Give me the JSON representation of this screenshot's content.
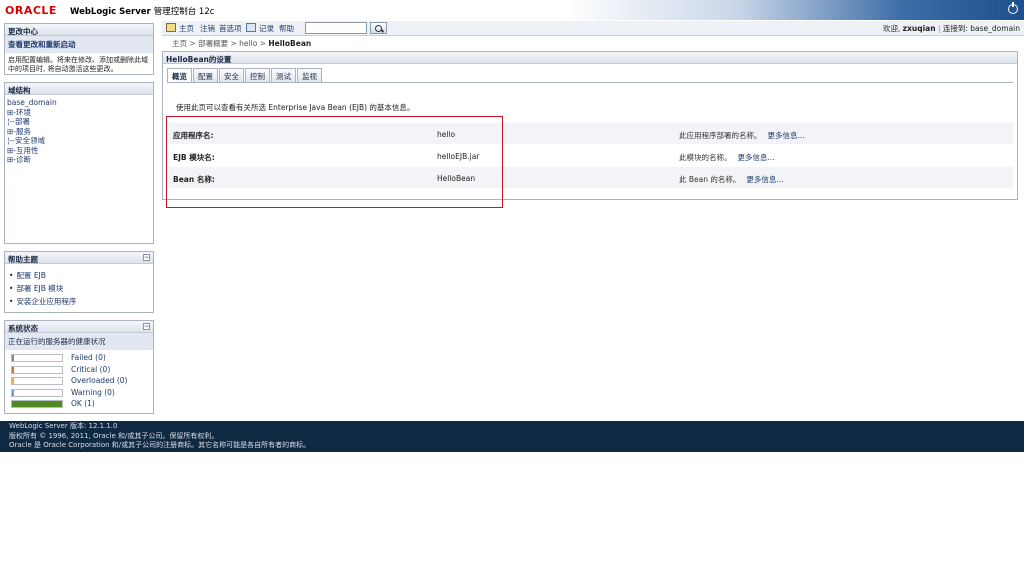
{
  "header": {
    "logo": "ORACLE",
    "product_name": "WebLogic Server",
    "product_sub": "管理控制台 12c"
  },
  "toolbar": {
    "home": "主页",
    "logout": "注销",
    "preferences": "首选项",
    "record": "记录",
    "help": "帮助",
    "search_value": "",
    "welcome_prefix": "欢迎,",
    "username": "zxuqian",
    "connected_prefix": "连接到:",
    "domain": "base_domain"
  },
  "change_center": {
    "title": "更改中心",
    "action": "查看更改和重新启动",
    "description": "启用配置编辑。将来在修改、添加或删除此域中的项目时, 将自动激活这些更改。"
  },
  "domain_structure": {
    "title": "域结构",
    "root": "base_domain",
    "items": [
      {
        "prefix": "⊞-",
        "label": "环境"
      },
      {
        "prefix": "¦--",
        "label": "部署"
      },
      {
        "prefix": "⊞-",
        "label": "服务"
      },
      {
        "prefix": "¦--",
        "label": "安全领域"
      },
      {
        "prefix": "⊞-",
        "label": "互用性"
      },
      {
        "prefix": "⊞-",
        "label": "诊断"
      }
    ]
  },
  "help_topics": {
    "title": "帮助主题",
    "items": [
      "配置 EJB",
      "部署 EJB 模块",
      "安装企业应用程序"
    ]
  },
  "system_status": {
    "title": "系统状态",
    "heading": "正在运行的服务器的健康状况",
    "rows": [
      {
        "label": "Failed (0)",
        "color": "#8a8a8a",
        "fill": 0
      },
      {
        "label": "Critical (0)",
        "color": "#e06a2a",
        "fill": 0
      },
      {
        "label": "Overloaded (0)",
        "color": "#e0b05a",
        "fill": 0
      },
      {
        "label": "Warning (0)",
        "color": "#6a9ad0",
        "fill": 0
      },
      {
        "label": "OK (1)",
        "color": "#4e8a1e",
        "fill": 1
      }
    ]
  },
  "breadcrumb": {
    "items": [
      "主页",
      "部署概要",
      "hello"
    ],
    "current": "HelloBean",
    "sep": ">"
  },
  "content": {
    "title": "HelloBean的设置",
    "tabs": [
      "概览",
      "配置",
      "安全",
      "控制",
      "测试",
      "监视"
    ],
    "active_tab": 0,
    "intro": "使用此页可以查看有关所选 Enterprise Java Bean (EJB) 的基本信息。",
    "rows": [
      {
        "label": "应用程序名:",
        "value": "hello",
        "help": "此应用程序部署的名称。",
        "more": "更多信息..."
      },
      {
        "label": "EJB 模块名:",
        "value": "helloEJB.jar",
        "help": "此模块的名称。",
        "more": "更多信息..."
      },
      {
        "label": "Bean 名称:",
        "value": "HelloBean",
        "help": "此 Bean 的名称。",
        "more": "更多信息..."
      }
    ]
  },
  "footer": {
    "line1": "WebLogic Server 版本: 12.1.1.0",
    "line2": "版权所有 © 1996, 2011, Oracle 和/或其子公司。保留所有权利。",
    "line3": "Oracle 是 Oracle Corporation 和/或其子公司的注册商标。其它名称可能是各自所有者的商标。"
  },
  "colors": {
    "highlight_rect": "#c3162a",
    "footer_bg": "#0f2942"
  }
}
